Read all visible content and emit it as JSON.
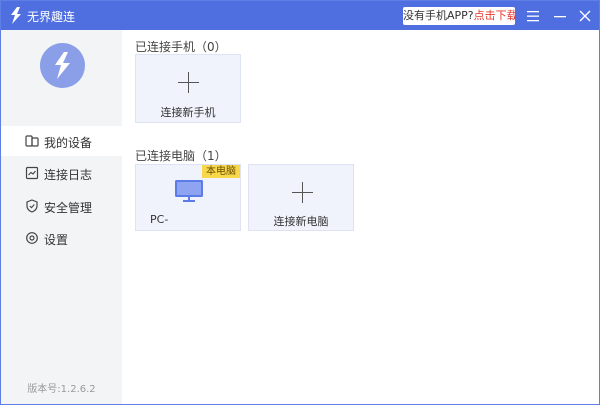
{
  "titlebar": {
    "app_title": "无界趣连",
    "promo_text": "没有手机APP?",
    "promo_link": "点击下载"
  },
  "sidebar": {
    "items": [
      {
        "label": "我的设备",
        "icon": "devices-icon",
        "active": true
      },
      {
        "label": "连接日志",
        "icon": "log-icon",
        "active": false
      },
      {
        "label": "安全管理",
        "icon": "shield-icon",
        "active": false
      },
      {
        "label": "设置",
        "icon": "gear-icon",
        "active": false
      }
    ],
    "version": "版本号:1.2.6.2"
  },
  "main": {
    "phones": {
      "title": "已连接手机（0）",
      "add_label": "连接新手机"
    },
    "computers": {
      "title": "已连接电脑（1）",
      "devices": [
        {
          "name": "PC-",
          "badge": "本电脑"
        }
      ],
      "add_label": "连接新电脑"
    }
  },
  "colors": {
    "accent": "#4f6fe0",
    "card_bg": "#f0f3fc",
    "badge": "#f7d84b",
    "link": "#e8382f"
  }
}
